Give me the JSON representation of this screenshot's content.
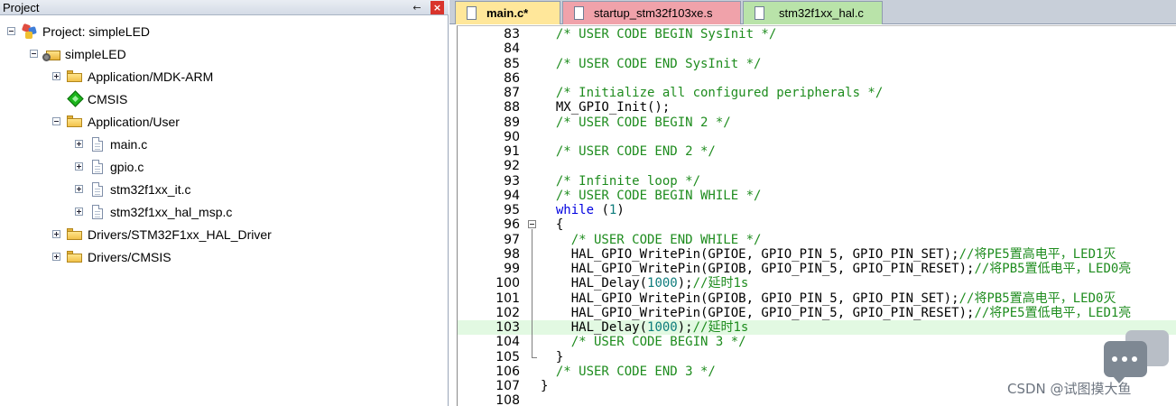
{
  "project_panel": {
    "title": "Project",
    "pin_glyph": "←",
    "close_glyph": "×",
    "tree": [
      {
        "label": "Project: simpleLED",
        "icon": "project-icon",
        "expander": "minus",
        "level": 0
      },
      {
        "label": "simpleLED",
        "icon": "target-icon",
        "expander": "minus",
        "level": 1
      },
      {
        "label": "Application/MDK-ARM",
        "icon": "folder-icon",
        "expander": "plus",
        "level": 2
      },
      {
        "label": "CMSIS",
        "icon": "cmsis-diamond-icon",
        "expander": "none",
        "level": 2
      },
      {
        "label": "Application/User",
        "icon": "folder-open-icon",
        "expander": "minus",
        "level": 2
      },
      {
        "label": "main.c",
        "icon": "file-icon",
        "expander": "plus",
        "level": 3
      },
      {
        "label": "gpio.c",
        "icon": "file-icon",
        "expander": "plus",
        "level": 3
      },
      {
        "label": "stm32f1xx_it.c",
        "icon": "file-icon",
        "expander": "plus",
        "level": 3
      },
      {
        "label": "stm32f1xx_hal_msp.c",
        "icon": "file-icon",
        "expander": "plus",
        "level": 3
      },
      {
        "label": "Drivers/STM32F1xx_HAL_Driver",
        "icon": "folder-icon",
        "expander": "plus",
        "level": 2
      },
      {
        "label": "Drivers/CMSIS",
        "icon": "folder-icon",
        "expander": "plus",
        "level": 2
      }
    ]
  },
  "tabs": [
    {
      "label": "main.c*",
      "color": "#ffe79a",
      "active": true
    },
    {
      "label": "startup_stm32f103xe.s",
      "color": "#f0a2aa",
      "active": false
    },
    {
      "label": "stm32f1xx_hal.c",
      "color": "#b9e3a9",
      "active": false
    }
  ],
  "editor": {
    "colors": {
      "comment": "#1e8c1e",
      "keyword": "#0000e0",
      "number": "#0e7c7c",
      "highlight": "#e2f9e2"
    },
    "highlighted_line": "103",
    "lines": [
      {
        "num": "83",
        "indent": "  ",
        "segments": [
          {
            "t": "cm",
            "text": "/* USER CODE BEGIN SysInit */"
          }
        ]
      },
      {
        "num": "84",
        "indent": "",
        "segments": []
      },
      {
        "num": "85",
        "indent": "  ",
        "segments": [
          {
            "t": "cm",
            "text": "/* USER CODE END SysInit */"
          }
        ]
      },
      {
        "num": "86",
        "indent": "",
        "segments": []
      },
      {
        "num": "87",
        "indent": "  ",
        "segments": [
          {
            "t": "cm",
            "text": "/* Initialize all configured peripherals */"
          }
        ]
      },
      {
        "num": "88",
        "indent": "  ",
        "segments": [
          {
            "t": "p",
            "text": "MX_GPIO_Init();"
          }
        ]
      },
      {
        "num": "89",
        "indent": "  ",
        "segments": [
          {
            "t": "cm",
            "text": "/* USER CODE BEGIN 2 */"
          }
        ]
      },
      {
        "num": "90",
        "indent": "",
        "segments": []
      },
      {
        "num": "91",
        "indent": "  ",
        "segments": [
          {
            "t": "cm",
            "text": "/* USER CODE END 2 */"
          }
        ]
      },
      {
        "num": "92",
        "indent": "",
        "segments": []
      },
      {
        "num": "93",
        "indent": "  ",
        "segments": [
          {
            "t": "cm",
            "text": "/* Infinite loop */"
          }
        ]
      },
      {
        "num": "94",
        "indent": "  ",
        "segments": [
          {
            "t": "cm",
            "text": "/* USER CODE BEGIN WHILE */"
          }
        ]
      },
      {
        "num": "95",
        "indent": "  ",
        "segments": [
          {
            "t": "kw",
            "text": "while"
          },
          {
            "t": "p",
            "text": " ("
          },
          {
            "t": "num",
            "text": "1"
          },
          {
            "t": "p",
            "text": ")"
          }
        ]
      },
      {
        "num": "96",
        "indent": "  ",
        "segments": [
          {
            "t": "p",
            "text": "{"
          }
        ]
      },
      {
        "num": "97",
        "indent": "    ",
        "segments": [
          {
            "t": "cm",
            "text": "/* USER CODE END WHILE */"
          }
        ]
      },
      {
        "num": "98",
        "indent": "    ",
        "segments": [
          {
            "t": "p",
            "text": "HAL_GPIO_WritePin(GPIOE, GPIO_PIN_5, GPIO_PIN_SET);"
          },
          {
            "t": "cm",
            "text": "//将PE5置高电平，LED1灭"
          }
        ]
      },
      {
        "num": "99",
        "indent": "    ",
        "segments": [
          {
            "t": "p",
            "text": "HAL_GPIO_WritePin(GPIOB, GPIO_PIN_5, GPIO_PIN_RESET);"
          },
          {
            "t": "cm",
            "text": "//将PB5置低电平，LED0亮"
          }
        ]
      },
      {
        "num": "100",
        "indent": "    ",
        "segments": [
          {
            "t": "p",
            "text": "HAL_Delay("
          },
          {
            "t": "num",
            "text": "1000"
          },
          {
            "t": "p",
            "text": ");"
          },
          {
            "t": "cm",
            "text": "//延时1s"
          }
        ]
      },
      {
        "num": "101",
        "indent": "    ",
        "segments": [
          {
            "t": "p",
            "text": "HAL_GPIO_WritePin(GPIOB, GPIO_PIN_5, GPIO_PIN_SET);"
          },
          {
            "t": "cm",
            "text": "//将PB5置高电平，LED0灭"
          }
        ]
      },
      {
        "num": "102",
        "indent": "    ",
        "segments": [
          {
            "t": "p",
            "text": "HAL_GPIO_WritePin(GPIOE, GPIO_PIN_5, GPIO_PIN_RESET);"
          },
          {
            "t": "cm",
            "text": "//将PE5置低电平，LED1亮"
          }
        ]
      },
      {
        "num": "103",
        "indent": "    ",
        "segments": [
          {
            "t": "p",
            "text": "HAL_Delay("
          },
          {
            "t": "num",
            "text": "1000"
          },
          {
            "t": "p",
            "text": ");"
          },
          {
            "t": "cm",
            "text": "//延时1s"
          }
        ]
      },
      {
        "num": "104",
        "indent": "    ",
        "segments": [
          {
            "t": "cm",
            "text": "/* USER CODE BEGIN 3 */"
          }
        ]
      },
      {
        "num": "105",
        "indent": "  ",
        "segments": [
          {
            "t": "p",
            "text": "}"
          }
        ]
      },
      {
        "num": "106",
        "indent": "  ",
        "segments": [
          {
            "t": "cm",
            "text": "/* USER CODE END 3 */"
          }
        ]
      },
      {
        "num": "107",
        "indent": "",
        "segments": [
          {
            "t": "p",
            "text": "}"
          }
        ]
      },
      {
        "num": "108",
        "indent": "",
        "segments": []
      }
    ]
  },
  "watermark": {
    "text": "CSDN @试图摸大鱼",
    "icon": "chat-bubble-icon"
  }
}
